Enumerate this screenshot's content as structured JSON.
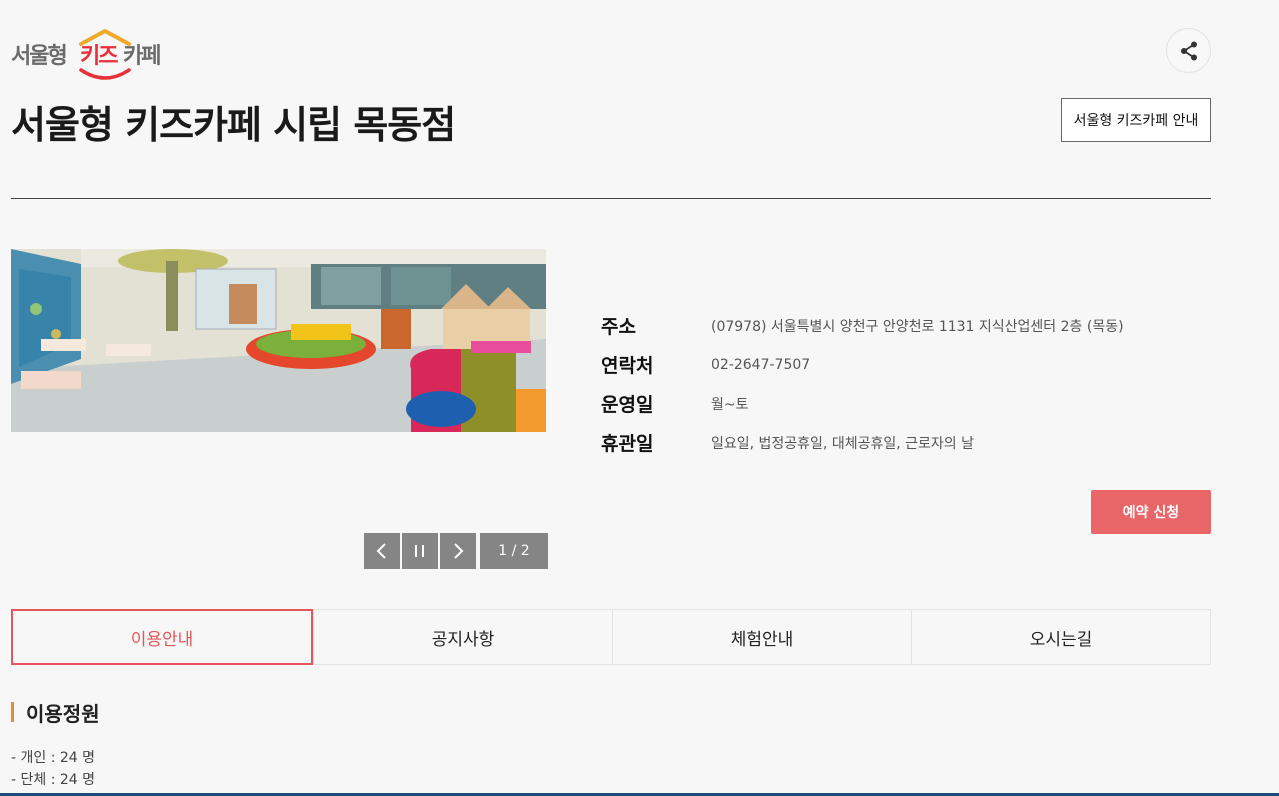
{
  "logo": {
    "part1": "서울형",
    "part2": "키즈",
    "part3": "카페"
  },
  "header": {
    "title": "서울형 키즈카페 시립 목동점",
    "guide_button": "서울형 키즈카페 안내",
    "share_icon": "share-icon"
  },
  "gallery": {
    "counter": "1 / 2",
    "controls": [
      "chevron-left-icon",
      "pause-icon",
      "chevron-right-icon"
    ]
  },
  "info": [
    {
      "label": "주소",
      "value": "(07978) 서울특별시 양천구 안양천로 1131 지식산업센터 2층 (목동)"
    },
    {
      "label": "연락처",
      "value": "02-2647-7507"
    },
    {
      "label": "운영일",
      "value": "월~토"
    },
    {
      "label": "휴관일",
      "value": "일요일, 법정공휴일, 대체공휴일, 근로자의 날"
    }
  ],
  "reserve_button": "예약 신청",
  "tabs": [
    {
      "label": "이용안내",
      "active": true
    },
    {
      "label": "공지사항",
      "active": false
    },
    {
      "label": "체험안내",
      "active": false
    },
    {
      "label": "오시는길",
      "active": false
    }
  ],
  "section": {
    "title": "이용정원",
    "lines": [
      "- 개인 : 24 명",
      "- 단체 : 24 명"
    ]
  },
  "colors": {
    "accent": "#e86668",
    "tab_active": "#e2585a",
    "section_bar": "#e38a3e"
  }
}
